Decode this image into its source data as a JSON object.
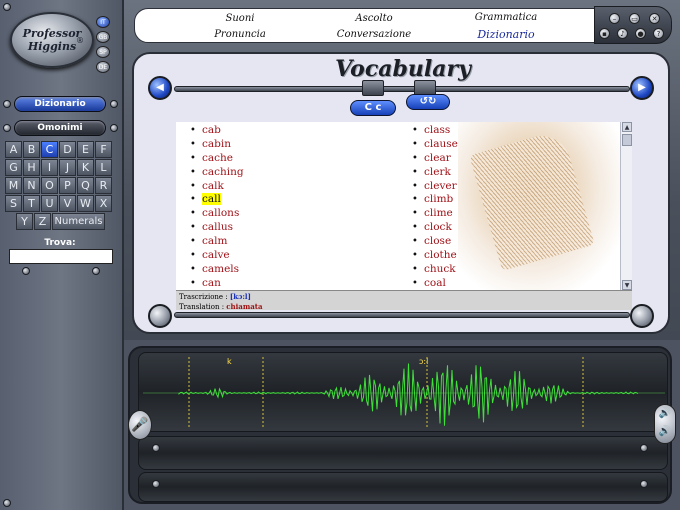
{
  "app": {
    "logo_line1": "Professor",
    "logo_line2": "Higgins",
    "logo_mark": "®"
  },
  "languages": [
    {
      "code": "IT",
      "active": true
    },
    {
      "code": "GB",
      "active": false
    },
    {
      "code": "SP",
      "active": false
    },
    {
      "code": "DE",
      "active": false
    }
  ],
  "sidebar": {
    "dizionario_label": "Dizionario",
    "omonimi_label": "Omonimi",
    "alphabet_rows": [
      [
        "A",
        "B",
        "C",
        "D",
        "E",
        "F"
      ],
      [
        "G",
        "H",
        "I",
        "J",
        "K",
        "L"
      ],
      [
        "M",
        "N",
        "O",
        "P",
        "Q",
        "R"
      ],
      [
        "S",
        "T",
        "U",
        "V",
        "W",
        "X"
      ]
    ],
    "alphabet_last": [
      "Y",
      "Z"
    ],
    "numerals_label": "Numerals",
    "active_letter": "C",
    "trova_label": "Trova:",
    "trova_value": ""
  },
  "menu": {
    "suoni": "Suoni",
    "pronuncia": "Pronuncia",
    "ascolto": "Ascolto",
    "conversazione": "Conversazione",
    "grammatica": "Grammatica",
    "dizionario": "Dizionario"
  },
  "vocab": {
    "title": "Vocabulary",
    "case_button": "C c",
    "back_button": "↺↻",
    "column1": [
      "cab",
      "cabin",
      "cache",
      "caching",
      "calk",
      "call",
      "callons",
      "callus",
      "calm",
      "calve",
      "camels",
      "can"
    ],
    "column2": [
      "class",
      "clause",
      "clear",
      "clerk",
      "clever",
      "climb",
      "clime",
      "clock",
      "close",
      "clothe",
      "chuck",
      "coal"
    ],
    "selected": "call",
    "trascrizione_label": "Trascrizione :",
    "trascrizione_value": "[kɔ:l]",
    "translation_label": "Translation :",
    "translation_value": "chiamata"
  },
  "wave": {
    "phoneme1": "k",
    "phoneme2": "ɔ:l"
  },
  "colors": {
    "accent_blue": "#1d3fb0",
    "word_red": "#a0141a",
    "wave_green": "#3fe03a",
    "highlight": "#ffff00"
  }
}
